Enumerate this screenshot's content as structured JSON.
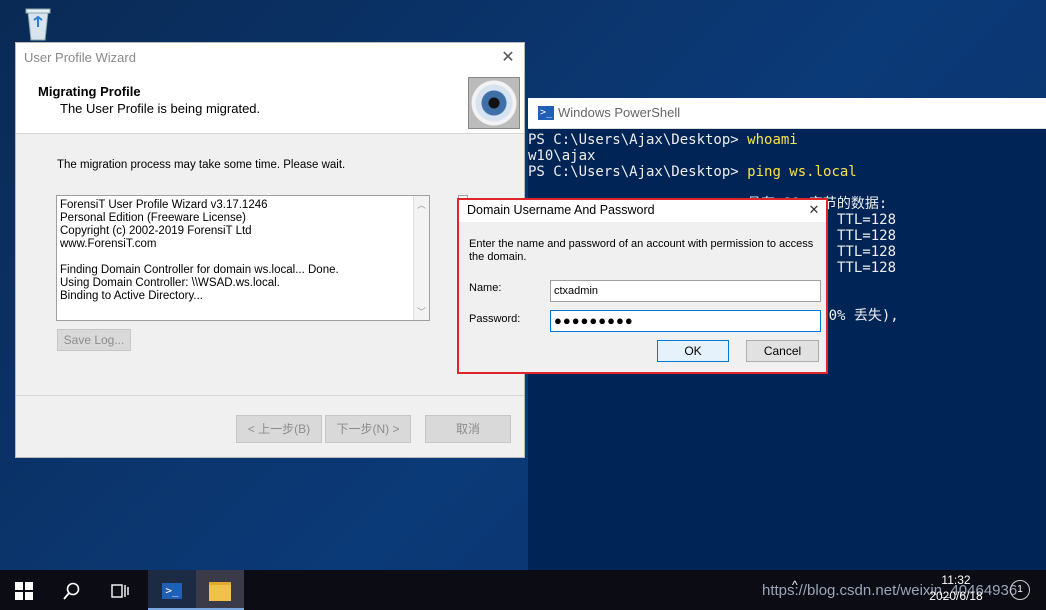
{
  "wizard": {
    "title": "User Profile Wizard",
    "header_title": "Migrating Profile",
    "header_subtitle": "The User Profile is being migrated.",
    "message": "The migration process may take some time. Please wait.",
    "log_lines": [
      "ForensiT User Profile Wizard v3.17.1246",
      "Personal Edition (Freeware License)",
      "Copyright (c) 2002-2019 ForensiT Ltd",
      "www.ForensiT.com",
      "",
      "Finding Domain Controller for domain ws.local... Done.",
      "Using Domain Controller: \\\\WSAD.ws.local.",
      "Binding to Active Directory..."
    ],
    "save_log_label": "Save Log...",
    "back_label": "< 上一步(B)",
    "next_label": "下一步(N) >",
    "cancel_label": "取消"
  },
  "powershell": {
    "title": "Windows PowerShell",
    "lines": [
      {
        "prompt": "PS C:\\Users\\Ajax\\Desktop> ",
        "cmd": "whoami"
      },
      {
        "prompt": "w10\\ajax",
        "cmd": ""
      },
      {
        "prompt": "PS C:\\Users\\Ajax\\Desktop> ",
        "cmd": "ping ws.local"
      },
      {
        "prompt": "",
        "cmd": ""
      },
      {
        "prompt": "                          具有 32 字节的数据:",
        "cmd": ""
      },
      {
        "prompt": "                              间<1ms TTL=128",
        "cmd": ""
      },
      {
        "prompt": "                              间<1ms TTL=128",
        "cmd": ""
      },
      {
        "prompt": "                              间<1ms TTL=128",
        "cmd": ""
      },
      {
        "prompt": "                              间=1ms TTL=128",
        "cmd": ""
      },
      {
        "prompt": "",
        "cmd": ""
      },
      {
        "prompt": "",
        "cmd": ""
      },
      {
        "prompt": "                            失 = 0 (0% 丢失),",
        "cmd": ""
      }
    ]
  },
  "dialog": {
    "title": "Domain Username And Password",
    "instructions": "Enter the name and password of an account with permission to access the domain.",
    "name_label": "Name:",
    "name_value": "ctxadmin",
    "password_label": "Password:",
    "password_value": "●●●●●●●●●",
    "ok_label": "OK",
    "cancel_label": "Cancel"
  },
  "taskbar": {
    "time": "11:32",
    "date": "2020/6/18",
    "watermark": "https://blog.csdn.net/weixin_40464936"
  },
  "colors": {
    "powershell_bg": "#012456",
    "highlight_border": "#e0262b",
    "focus_blue": "#0078d7"
  }
}
